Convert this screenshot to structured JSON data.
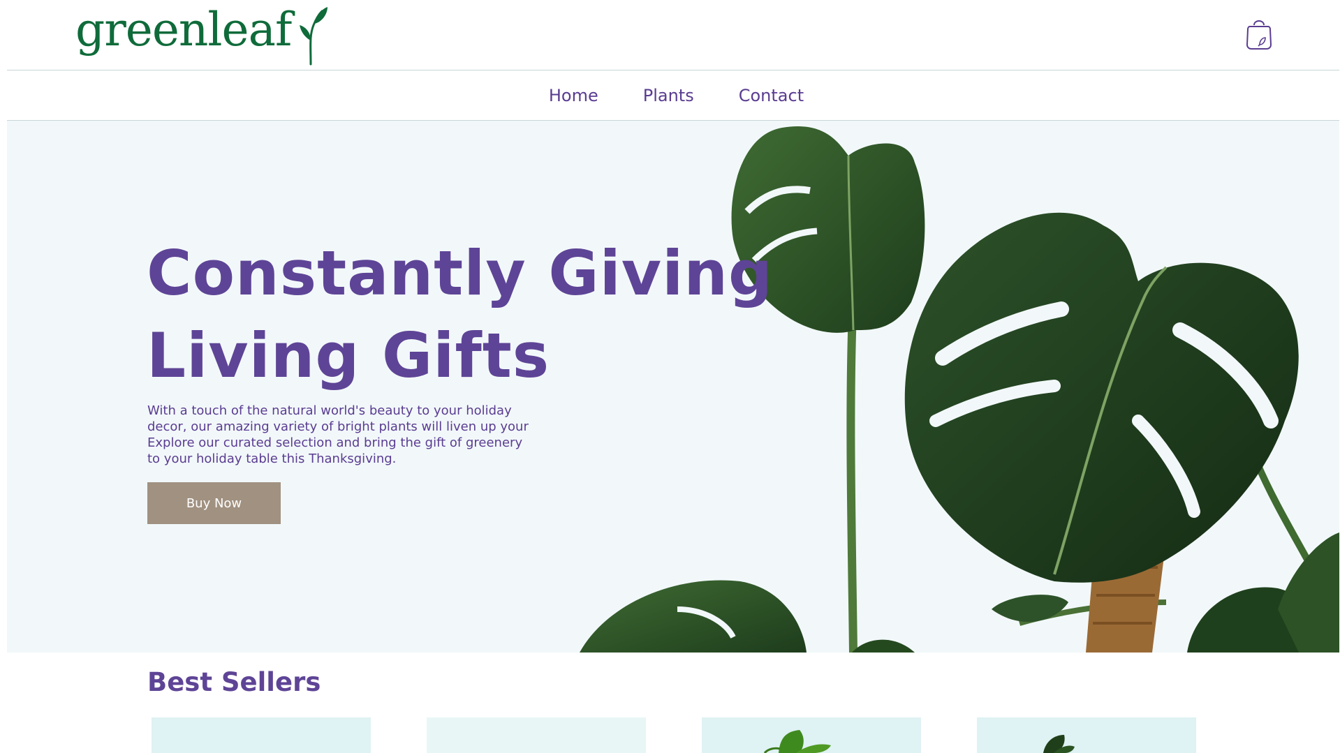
{
  "brand": {
    "name": "greenleaf",
    "colors": {
      "primary": "#5e4496",
      "logo": "#0f6b3a",
      "button": "#a19181",
      "hero_bg": "#f2f8fa"
    }
  },
  "header": {
    "cart_icon": "shopping-bag-icon"
  },
  "nav": {
    "items": [
      {
        "label": "Home"
      },
      {
        "label": "Plants"
      },
      {
        "label": "Contact"
      }
    ]
  },
  "hero": {
    "title_line1": "Constantly Giving",
    "title_line2": "Living Gifts",
    "description": "With a touch of the natural world's beauty to your holiday decor, our amazing variety of bright plants will liven up your Explore our curated selection and bring the gift of greenery to your holiday table this Thanksgiving.",
    "button_label": "Buy Now",
    "image": "monstera-plant-image"
  },
  "best_sellers": {
    "title": "Best Sellers",
    "cards": [
      {
        "image": "product-image",
        "bg": "#dff2f4"
      },
      {
        "image": "product-image",
        "bg": "#e9f6f6"
      },
      {
        "image": "plant-image",
        "bg": "#dff2f4"
      },
      {
        "image": "plant-image",
        "bg": "#dff2f4"
      }
    ]
  }
}
